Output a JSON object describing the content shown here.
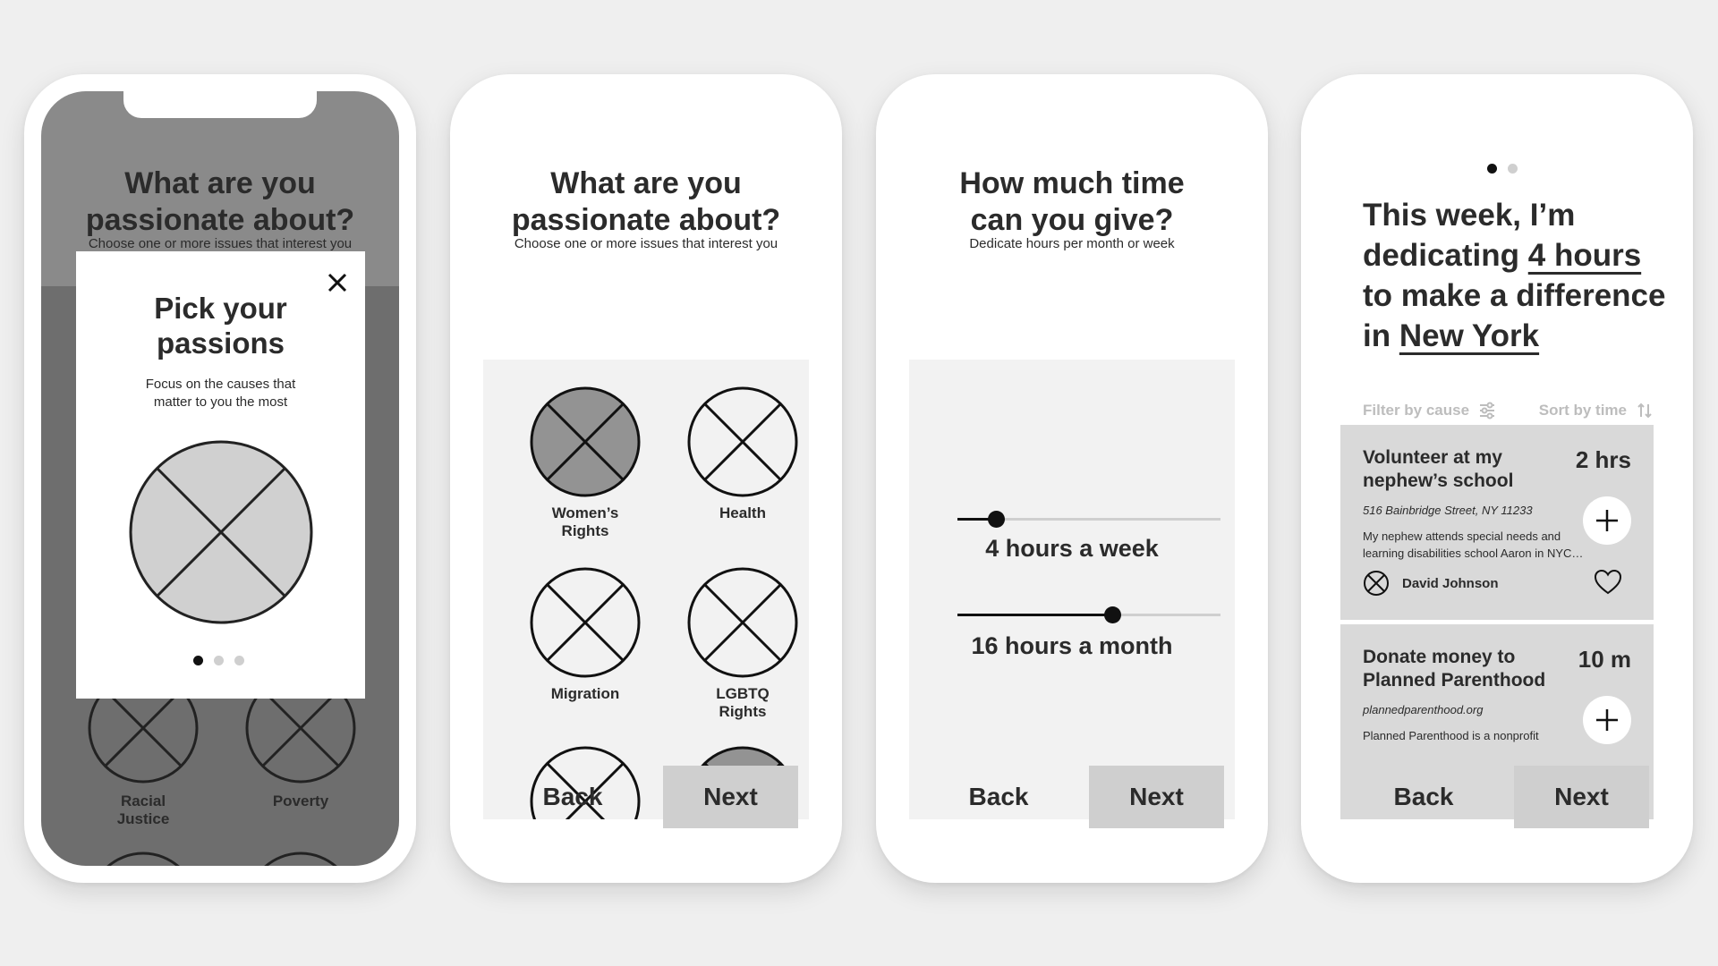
{
  "colors": {
    "background": "#efefef",
    "phone": "#ffffff",
    "text": "#2b2b2b",
    "panel": "#f2f2f2",
    "placeholder_selected": "#939393",
    "placeholder_light": "#d0d0d0",
    "overlay_dark": "#6e6e6e",
    "overlay_mid": "#8a8a8a",
    "button": "#cfcfcf",
    "card": "#d9d9d9",
    "muted": "#bdbdbd"
  },
  "screen1": {
    "title_line1": "What are you",
    "title_line2": "passionate about?",
    "subtitle": "Choose one or more issues that interest you",
    "modal": {
      "title_line1": "Pick your",
      "title_line2": "passions",
      "desc_line1": "Focus on the causes that",
      "desc_line2": "matter to you the most",
      "close_icon": "close-icon",
      "dots_active": 1,
      "dots_total": 3
    },
    "background_items": [
      {
        "label_line1": "Racial",
        "label_line2": "Justice"
      },
      {
        "label_line1": "Poverty",
        "label_line2": ""
      }
    ]
  },
  "screen2": {
    "title_line1": "What are you",
    "title_line2": "passionate about?",
    "subtitle": "Choose one or more issues that interest you",
    "items": [
      {
        "label_line1": "Women’s",
        "label_line2": "Rights",
        "selected": true
      },
      {
        "label_line1": "Health",
        "label_line2": "",
        "selected": false
      },
      {
        "label_line1": "Migration",
        "label_line2": "",
        "selected": false
      },
      {
        "label_line1": "LGBTQ",
        "label_line2": "Rights",
        "selected": false
      },
      {
        "label_line1": "",
        "label_line2": "",
        "selected": false
      },
      {
        "label_line1": "",
        "label_line2": "",
        "selected": true
      }
    ],
    "back_label": "Back",
    "next_label": "Next"
  },
  "screen3": {
    "title_line1": "How much time",
    "title_line2": "can you give?",
    "subtitle": "Dedicate hours per month or week",
    "sliders": [
      {
        "value_label": "4 hours a week",
        "fraction": 0.145
      },
      {
        "value_label": "16 hours a month",
        "fraction": 0.59
      }
    ],
    "back_label": "Back",
    "next_label": "Next"
  },
  "screen4": {
    "dots_active": 1,
    "dots_total": 2,
    "heading_line1": "This week, I’m",
    "heading_line2_prefix": "dedicating ",
    "heading_hours": "4 hours",
    "heading_line3": "to make a difference",
    "heading_line4_prefix": "in ",
    "heading_city": "New York",
    "filter_label": "Filter by cause",
    "filter_icon": "sliders-icon",
    "sort_label": "Sort by time",
    "sort_icon": "sort-icon",
    "cards": [
      {
        "title_line1": "Volunteer at my",
        "title_line2": "nephew’s school",
        "time": "2 hrs",
        "address": "516 Bainbridge Street, NY 11233",
        "desc_line1": "My nephew attends special needs and",
        "desc_line2": "learning disabilities school Aaron in NYC…",
        "author": "David Johnson"
      },
      {
        "title_line1": "Donate money to",
        "title_line2": "Planned Parenthood",
        "time": "10 m",
        "address": "plannedparenthood.org",
        "desc_line1": "Planned Parenthood is a nonprofit",
        "desc_line2": "",
        "author": ""
      }
    ],
    "back_label": "Back",
    "next_label": "Next"
  }
}
